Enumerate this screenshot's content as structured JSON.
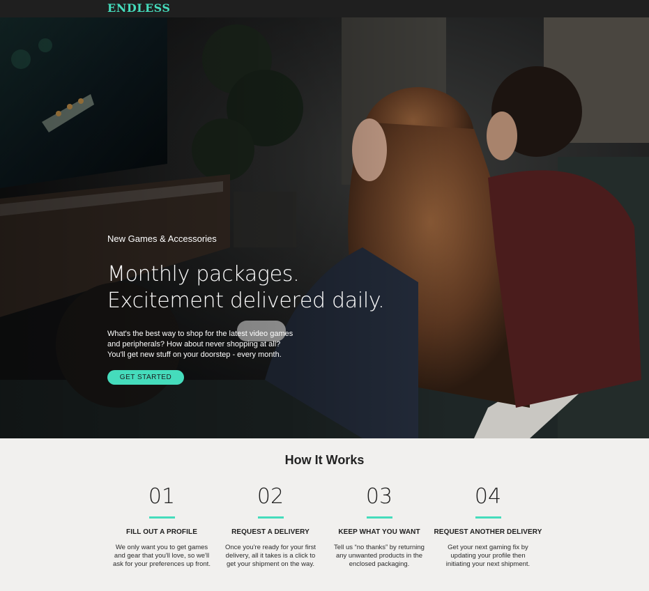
{
  "brand": {
    "logo": "ENDLESS",
    "accent_color": "#45dcbc"
  },
  "hero": {
    "eyebrow": "New Games & Accessories",
    "headline": [
      "Monthly packages.",
      "Excitement delivered daily."
    ],
    "lede": [
      "What's the best way to shop for the latest video games",
      "and peripherals? How about never shopping at all?",
      "You'll get new stuff on your doorstep - every month."
    ],
    "cta_label": "GET STARTED"
  },
  "how_it_works": {
    "title": "How It Works",
    "steps": [
      {
        "number": "01",
        "title": "FILL OUT A PROFILE",
        "desc": [
          "We only want you to get games",
          "and gear that you'll love, so we'll",
          "ask for your preferences up front."
        ]
      },
      {
        "number": "02",
        "title": "REQUEST A DELIVERY",
        "desc": [
          "Once you're ready for your first",
          "delivery, all it takes is a click to",
          "get your shipment on the way."
        ]
      },
      {
        "number": "03",
        "title": "KEEP WHAT YOU WANT",
        "desc": [
          "Tell us “no thanks” by returning",
          "any unwanted products in the",
          "enclosed packaging."
        ]
      },
      {
        "number": "04",
        "title": "REQUEST ANOTHER DELIVERY",
        "desc": [
          "Get your next gaming fix by",
          "updating your profile then",
          "initiating your next shipment."
        ]
      }
    ]
  }
}
